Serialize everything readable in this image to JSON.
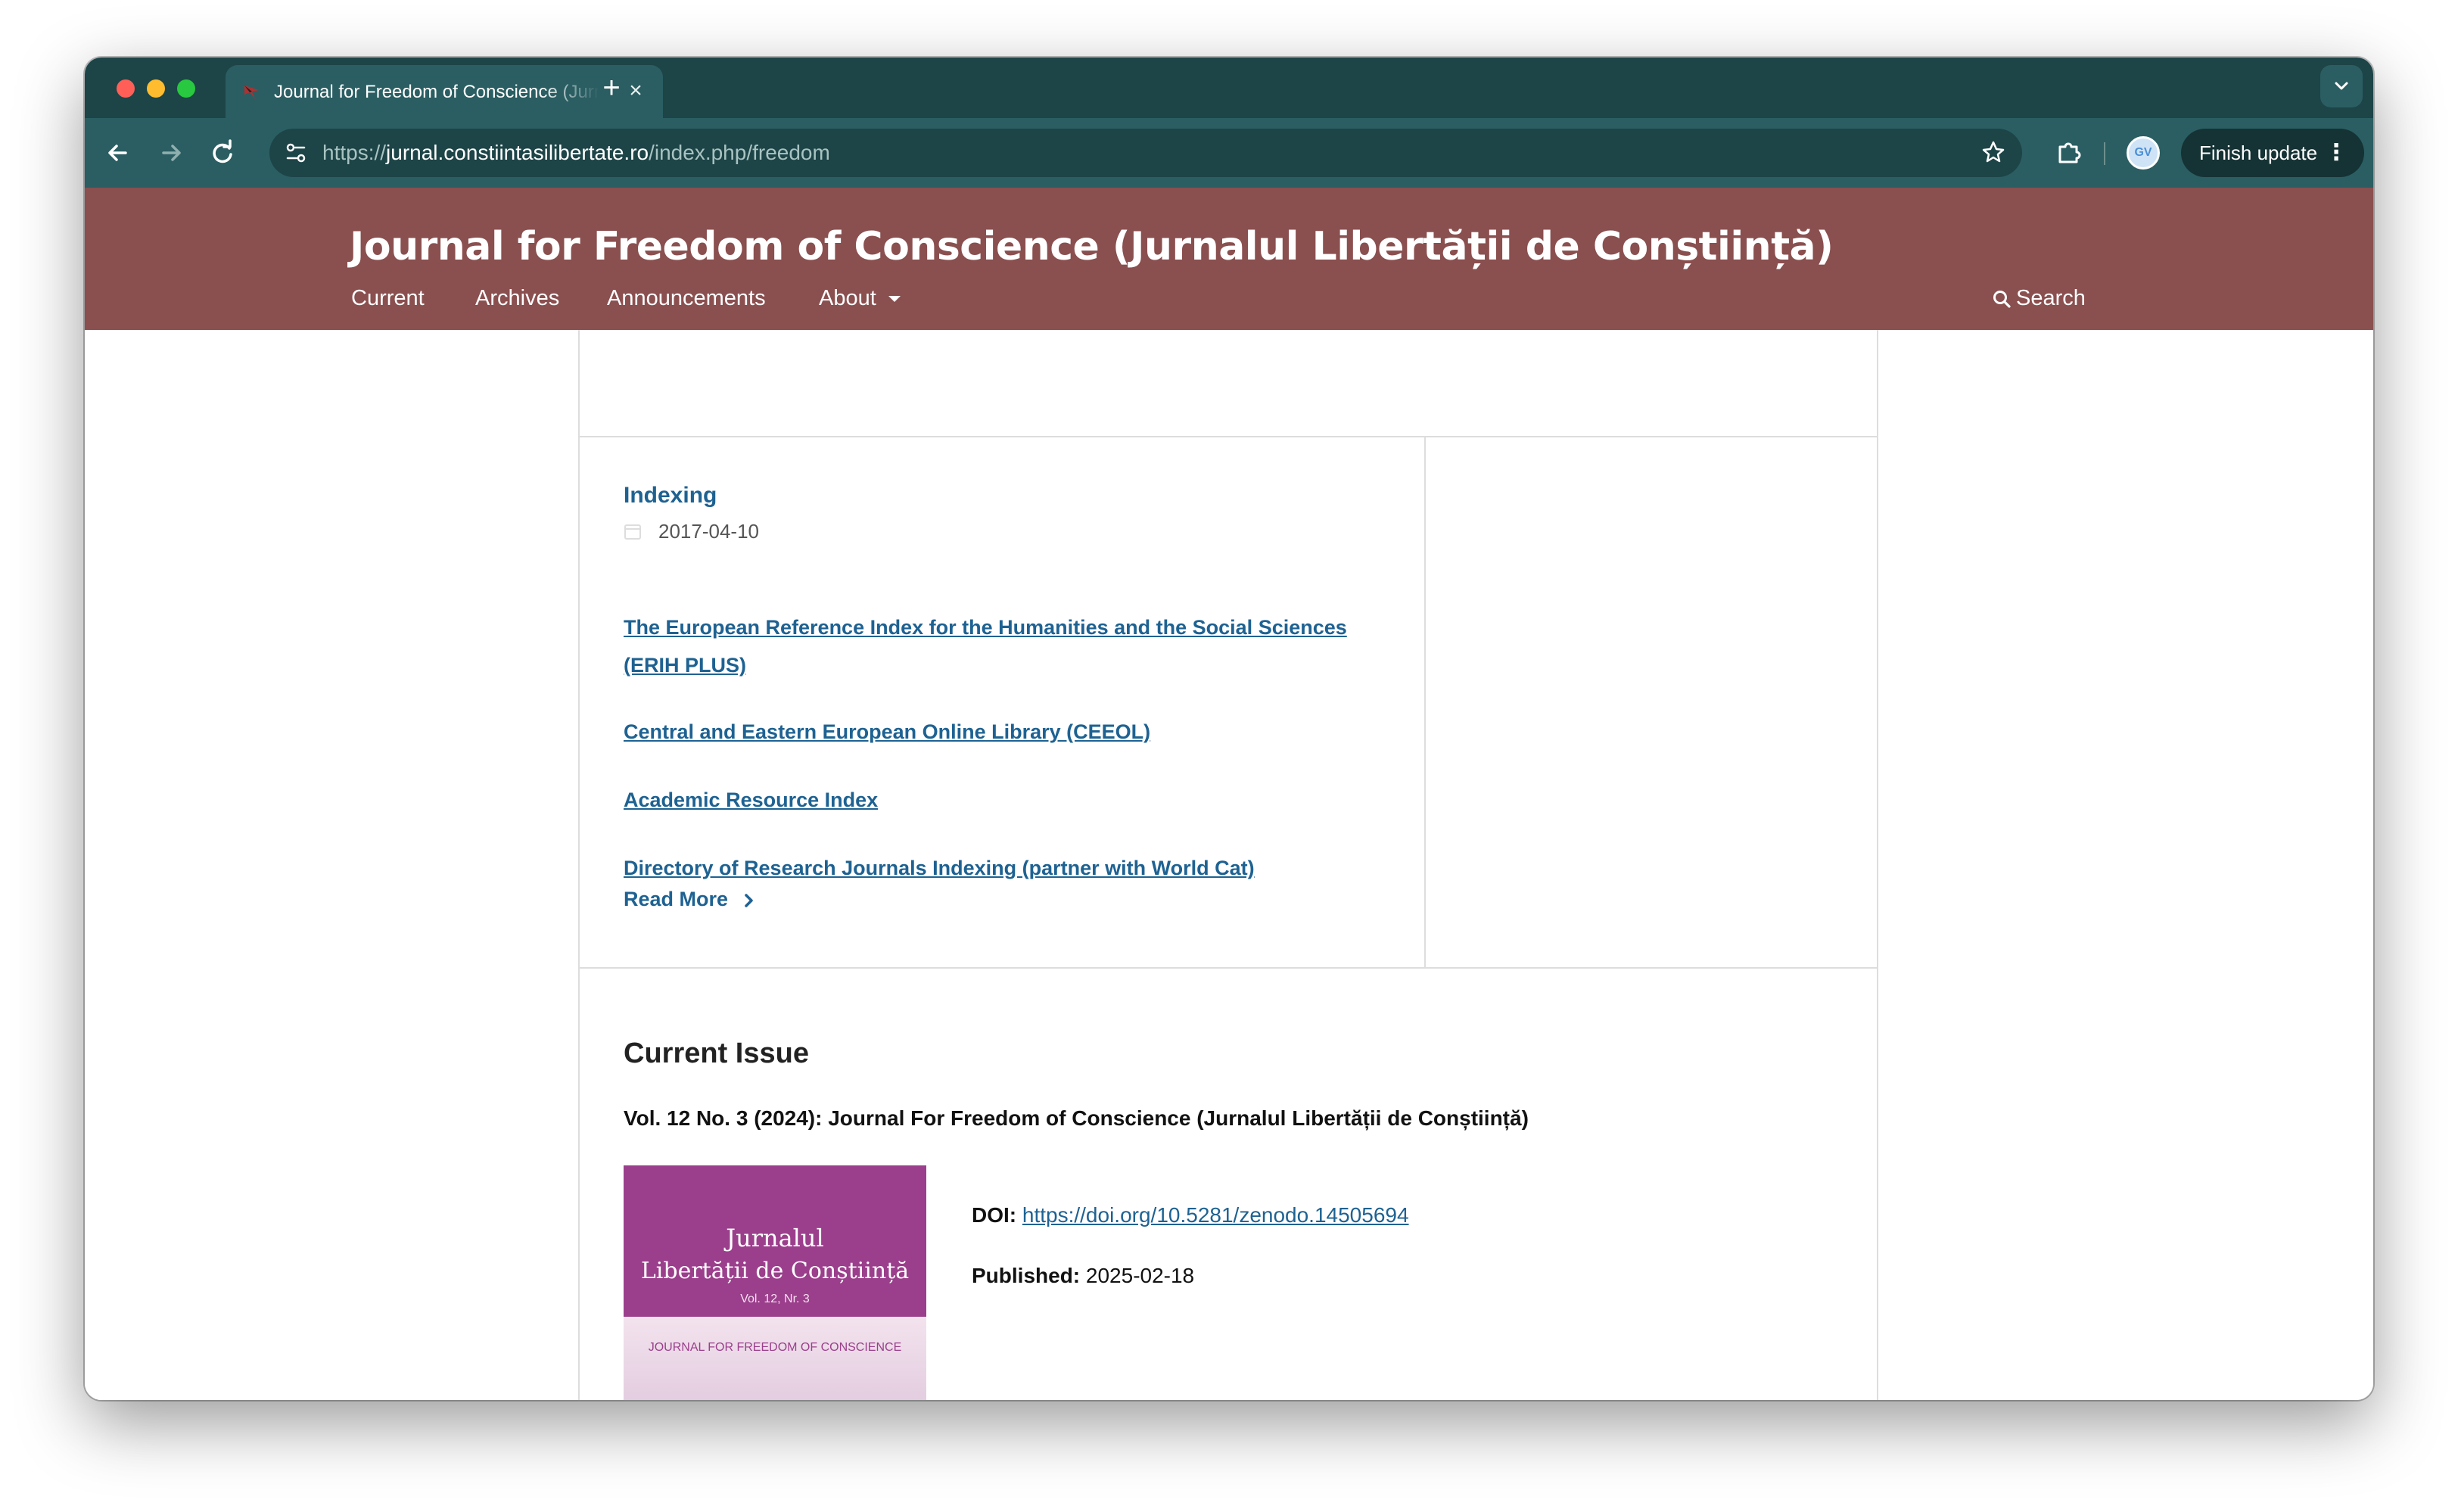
{
  "browser": {
    "tab_title": "Journal for Freedom of Conscience (Jurnalul Libertății de Conștiință)",
    "url_scheme": "https://",
    "url_host": "jurnal.constiintasilibertate.ro",
    "url_path": "/index.php/freedom",
    "update_button_label": "Finish update",
    "profile_initials": "GV"
  },
  "site": {
    "title": "Journal for Freedom of Conscience (Jurnalul Libertății de Conștiință)",
    "nav": {
      "current": "Current",
      "archives": "Archives",
      "announcements": "Announcements",
      "about": "About"
    },
    "search_label": "Search"
  },
  "announcement": {
    "title": "Indexing",
    "date": "2017-04-10",
    "links": [
      "The European Reference Index for the Humanities and the Social Sciences (ERIH PLUS)",
      "Central and Eastern European Online Library (CEEOL)",
      "Academic Resource Index",
      "Directory of Research Journals Indexing (partner with World Cat)"
    ],
    "read_more": "Read More"
  },
  "current_issue": {
    "heading": "Current Issue",
    "title": "Vol. 12 No. 3 (2024): Journal For Freedom of Conscience (Jurnalul Libertății de Conștiință)",
    "cover": {
      "line1": "Jurnalul",
      "line2": "Libertății de Conștiință",
      "line3": "Vol. 12, Nr. 3",
      "line4": "JOURNAL FOR FREEDOM OF CONSCIENCE"
    },
    "doi_label": "DOI:",
    "doi_value": "https://doi.org/10.5281/zenodo.14505694",
    "published_label": "Published:",
    "published_value": "2025-02-18"
  },
  "colors": {
    "header_bg": "#8a4f4f",
    "link": "#1e6292",
    "browser_frame": "#1d4447",
    "cover_purple": "#9b3f8c"
  }
}
